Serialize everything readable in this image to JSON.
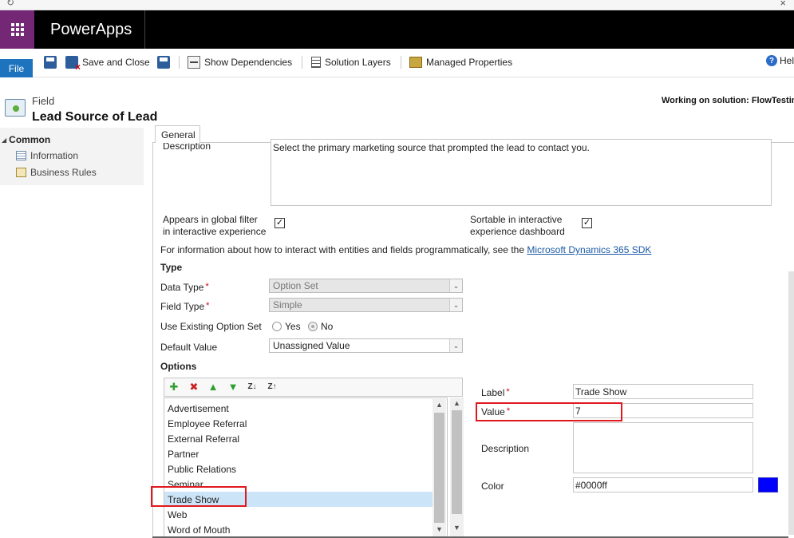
{
  "header_bar": {
    "app_title": "PowerApps"
  },
  "ribbon": {
    "file_label": "File",
    "save_close_label": "Save and Close",
    "show_dependencies_label": "Show Dependencies",
    "solution_layers_label": "Solution Layers",
    "managed_properties_label": "Managed Properties",
    "help_label": "Hel"
  },
  "page": {
    "kicker": "Field",
    "title": "Lead Source of Lead",
    "working_on": "Working on solution: FlowTestin"
  },
  "left_nav": {
    "group_label": "Common",
    "items": [
      {
        "label": "Information",
        "icon": "information-icon"
      },
      {
        "label": "Business Rules",
        "icon": "business-rules-icon"
      }
    ]
  },
  "form": {
    "tab_label": "General",
    "description_label": "Description",
    "description_value": "Select the primary marketing source that prompted the lead to contact you.",
    "global_filter_label_1": "Appears in global filter",
    "global_filter_label_2": "in interactive experience",
    "global_filter_checked": true,
    "sortable_label_1": "Sortable in interactive",
    "sortable_label_2": "experience dashboard",
    "sortable_checked": true,
    "sdk_text": "For information about how to interact with entities and fields programmatically, see the ",
    "sdk_link": "Microsoft Dynamics 365 SDK",
    "type_header": "Type",
    "data_type_label": "Data Type",
    "data_type_value": "Option Set",
    "field_type_label": "Field Type",
    "field_type_value": "Simple",
    "use_existing_label": "Use Existing Option Set",
    "yes_label": "Yes",
    "no_label": "No",
    "default_value_label": "Default Value",
    "default_value_value": "Unassigned Value",
    "options_header": "Options"
  },
  "options": {
    "items": [
      "Advertisement",
      "Employee Referral",
      "External Referral",
      "Partner",
      "Public Relations",
      "Seminar",
      "Trade Show",
      "Web",
      "Word of Mouth"
    ],
    "selected": "Trade Show"
  },
  "option_detail": {
    "label_label": "Label",
    "label_value": "Trade Show",
    "value_label": "Value",
    "value_value": "7",
    "description_label": "Description",
    "description_value": "",
    "color_label": "Color",
    "color_value": "#0000ff"
  },
  "colors": {
    "accent_purple": "#742774",
    "file_blue": "#1e73be",
    "highlight_red": "#e0191f",
    "selected_row": "#cce4f7",
    "link": "#1a5aa6"
  }
}
